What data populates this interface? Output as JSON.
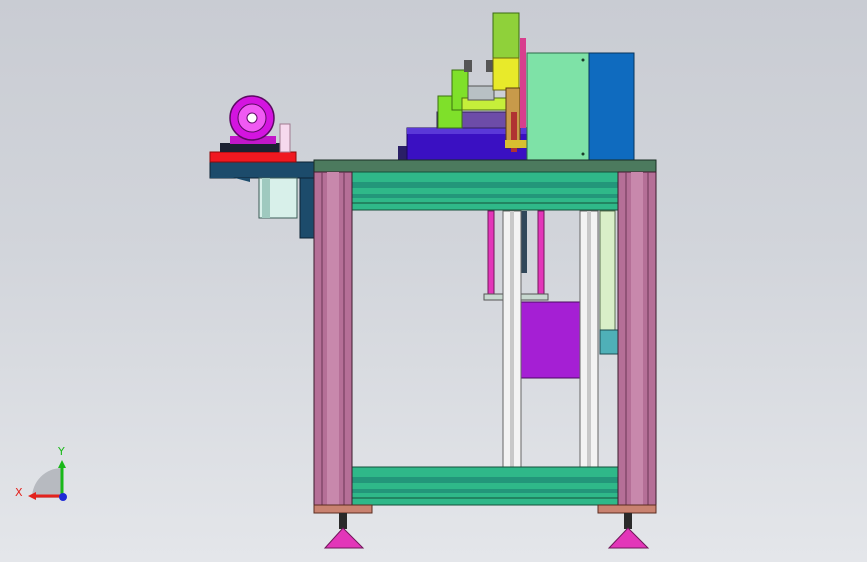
{
  "viewport": {
    "background_top": "#c9ccd3",
    "background_bottom": "#e4e6ea"
  },
  "triad": {
    "x_label": "X",
    "y_label": "Y",
    "x_color": "#e3221d",
    "y_color": "#19b819",
    "z_color": "#1f2bd6"
  },
  "colors": {
    "frame_post": "#b56f97",
    "frame_rail": "#2fb889",
    "table_top": "#4c7a5e",
    "foot": "#e336b9",
    "base_plate": "#3a10c2",
    "cabinet_light": "#7ee2a7",
    "cabinet_blue": "#0f6bbf",
    "motor_pink": "#d414e0",
    "purple_plate": "#a51fd4",
    "lime": "#7fe02a",
    "yellow": "#e8ea2a",
    "red": "#f01820"
  }
}
